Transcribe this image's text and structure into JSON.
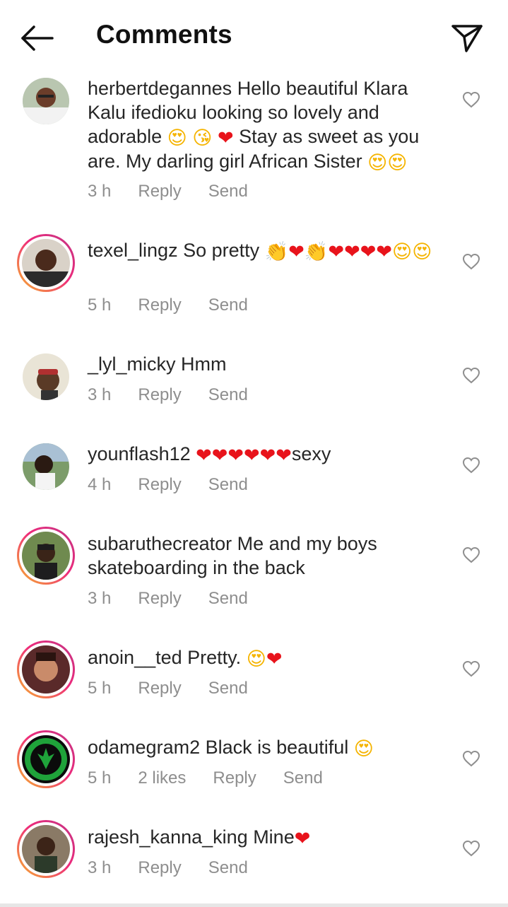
{
  "header": {
    "title": "Comments"
  },
  "comments": [
    {
      "username": "herbertdegannes",
      "text": "Hello beautiful Klara Kalu ifedioku looking so lovely and adorable",
      "text2": "Stay as sweet as you are. My darling girl African Sister",
      "time": "3 h",
      "reply": "Reply",
      "send": "Send"
    },
    {
      "username": "texel_lingz",
      "text": "So pretty",
      "time": "5 h",
      "reply": "Reply",
      "send": "Send"
    },
    {
      "username": "_lyl_micky",
      "text": "Hmm",
      "time": "3 h",
      "reply": "Reply",
      "send": "Send"
    },
    {
      "username": "younflash12",
      "text": "sexy",
      "time": "4 h",
      "reply": "Reply",
      "send": "Send"
    },
    {
      "username": "subaruthecreator",
      "text": "Me and my boys skateboarding in the back",
      "time": "3 h",
      "reply": "Reply",
      "send": "Send"
    },
    {
      "username": "anoin__ted",
      "text": "Pretty.",
      "time": "5 h",
      "reply": "Reply",
      "send": "Send"
    },
    {
      "username": "odamegram2",
      "text": "Black is beautiful",
      "time": "5 h",
      "likes": "2 likes",
      "reply": "Reply",
      "send": "Send"
    },
    {
      "username": "rajesh_kanna_king",
      "text": "Mine",
      "time": "3 h",
      "reply": "Reply",
      "send": "Send"
    }
  ],
  "colors": {
    "heart_emoji": "#e8131b",
    "meta_text": "#8e8e8e",
    "story_ring": "#ee2a7b"
  },
  "icons": {
    "back": "arrow-left-icon",
    "send": "paper-plane-icon",
    "like": "heart-outline-icon"
  }
}
